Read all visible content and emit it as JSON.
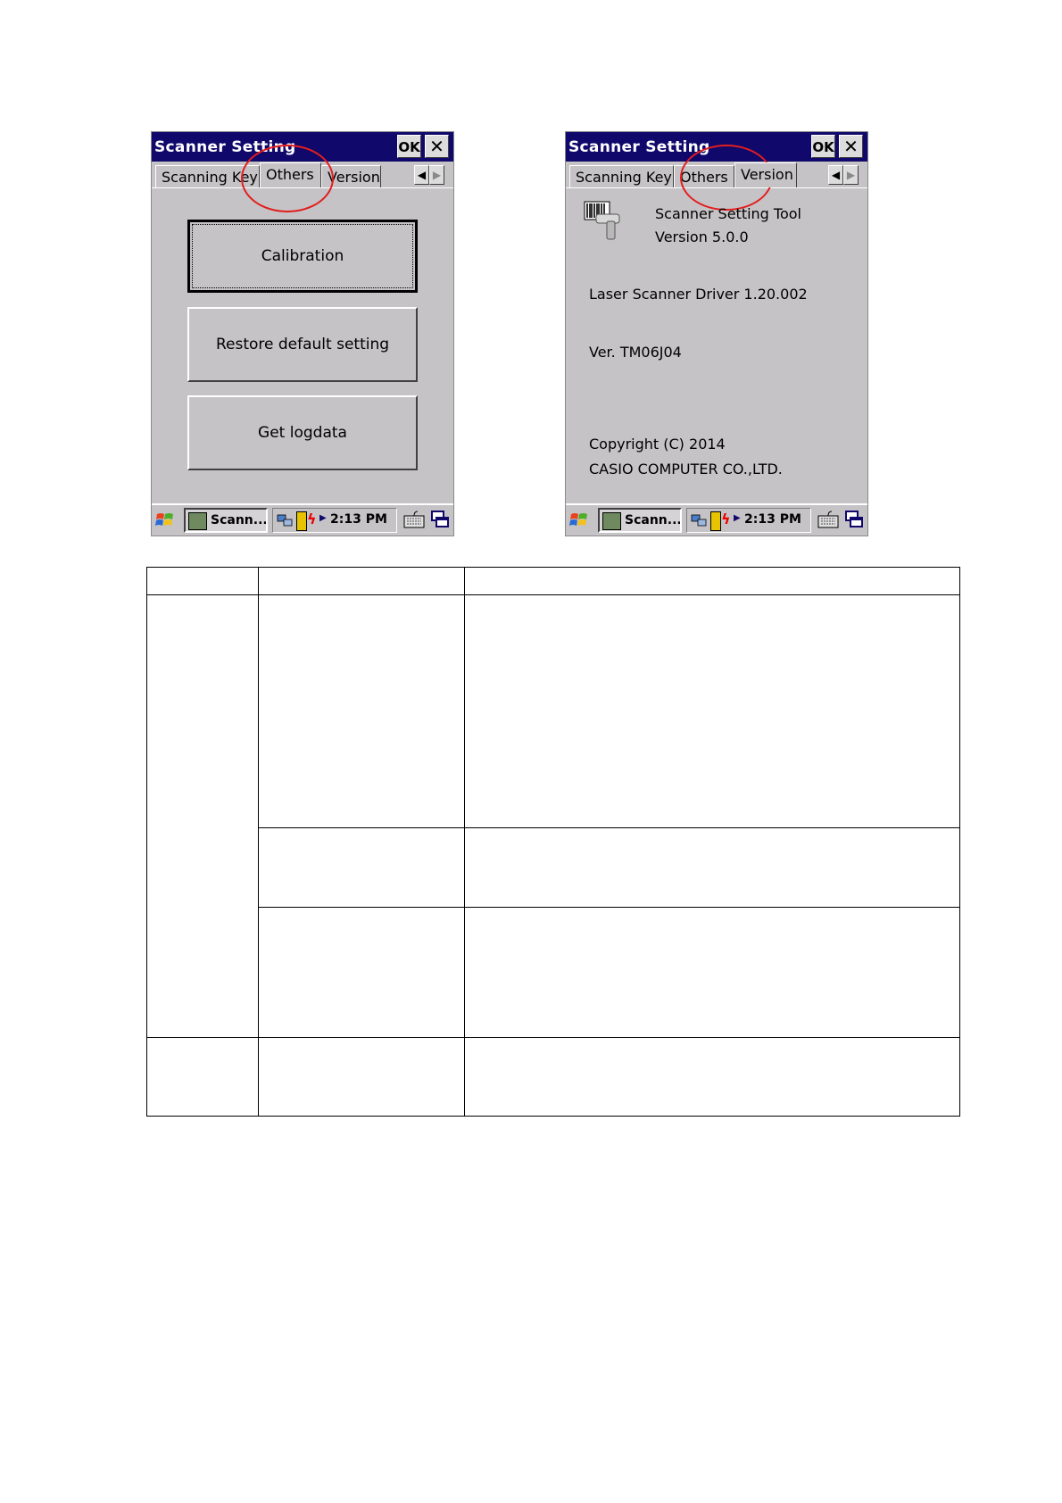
{
  "left_screen": {
    "title": "Scanner Setting",
    "ok_label": "OK",
    "close_label": "✕",
    "tabs": [
      "Scanning Key",
      "Others",
      "Version"
    ],
    "active_tab": "Others",
    "buttons": [
      "Calibration",
      "Restore default setting",
      "Get logdata"
    ],
    "taskbar": {
      "app_label": "Scann...",
      "time": "2:13 PM"
    }
  },
  "right_screen": {
    "title": "Scanner Setting",
    "ok_label": "OK",
    "close_label": "✕",
    "tabs": [
      "Scanning Key",
      "Others",
      "Version"
    ],
    "active_tab": "Version",
    "tool_name": "Scanner Setting Tool",
    "tool_version": "Version 5.0.0",
    "driver": "Laser Scanner Driver 1.20.002",
    "ver": "Ver. TM06J04",
    "copyright": "Copyright (C) 2014",
    "company": "CASIO COMPUTER CO.,LTD.",
    "taskbar": {
      "app_label": "Scann...",
      "time": "2:13 PM"
    }
  },
  "arrows": {
    "left": "◀",
    "right": "▶"
  },
  "colors": {
    "title_bar": "#10086b",
    "highlight_circle": "#e21e1e",
    "window_bg": "#c6c3c6"
  },
  "icons": [
    "windows-flag-icon",
    "scanner-app-icon",
    "network-icon",
    "battery-icon",
    "keyboard-icon",
    "switch-window-icon",
    "barcode-scanner-icon"
  ]
}
